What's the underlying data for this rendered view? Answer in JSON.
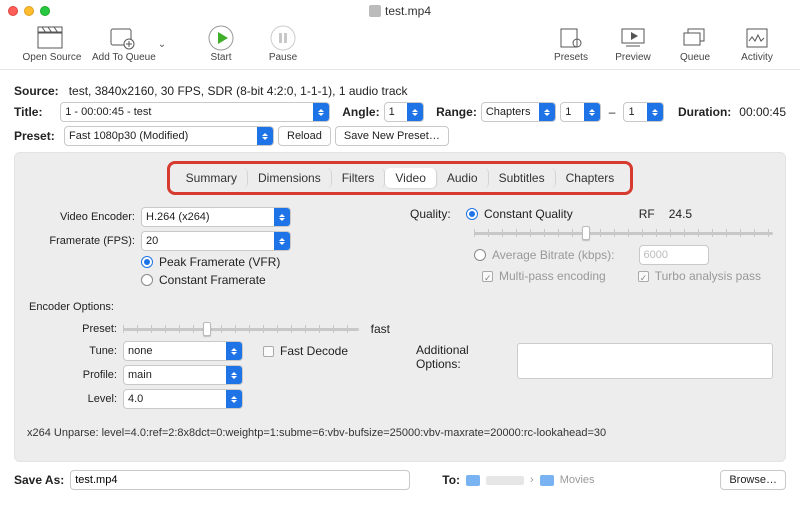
{
  "window": {
    "title": "test.mp4"
  },
  "toolbar": {
    "open_source": "Open Source",
    "add_to_queue": "Add To Queue",
    "start": "Start",
    "pause": "Pause",
    "presets": "Presets",
    "preview": "Preview",
    "queue": "Queue",
    "activity": "Activity"
  },
  "source": {
    "label": "Source:",
    "value": "test, 3840x2160, 30 FPS, SDR (8-bit 4:2:0, 1-1-1), 1 audio track"
  },
  "title": {
    "label": "Title:",
    "value": "1 - 00:00:45 - test"
  },
  "angle": {
    "label": "Angle:",
    "value": "1"
  },
  "range": {
    "label": "Range:",
    "value": "Chapters",
    "from": "1",
    "to": "1"
  },
  "duration": {
    "label": "Duration:",
    "value": "00:00:45"
  },
  "preset": {
    "label": "Preset:",
    "value": "Fast 1080p30 (Modified)",
    "reload": "Reload",
    "save_new": "Save New Preset…"
  },
  "tabs": [
    "Summary",
    "Dimensions",
    "Filters",
    "Video",
    "Audio",
    "Subtitles",
    "Chapters"
  ],
  "active_tab": "Video",
  "video": {
    "encoder_label": "Video Encoder:",
    "encoder": "H.264 (x264)",
    "fps_label": "Framerate (FPS):",
    "fps": "20",
    "peak": "Peak Framerate (VFR)",
    "constant_fr": "Constant Framerate",
    "quality_label": "Quality:",
    "constant_q": "Constant Quality",
    "rf_label": "RF",
    "rf_value": "24.5",
    "avg_bitrate": "Average Bitrate (kbps):",
    "bitrate_value": "6000",
    "multipass": "Multi-pass encoding",
    "turbo": "Turbo analysis pass"
  },
  "encoder_opts": {
    "header": "Encoder Options:",
    "preset_label": "Preset:",
    "preset_value": "fast",
    "tune_label": "Tune:",
    "tune_value": "none",
    "fast_decode": "Fast Decode",
    "profile_label": "Profile:",
    "profile_value": "main",
    "addl_label": "Additional Options:",
    "level_label": "Level:",
    "level_value": "4.0",
    "unparse": "x264 Unparse: level=4.0:ref=2:8x8dct=0:weightp=1:subme=6:vbv-bufsize=25000:vbv-maxrate=20000:rc-lookahead=30"
  },
  "footer": {
    "save_as_label": "Save As:",
    "save_as_value": "test.mp4",
    "to_label": "To:",
    "path2": "Movies",
    "browse": "Browse…"
  }
}
